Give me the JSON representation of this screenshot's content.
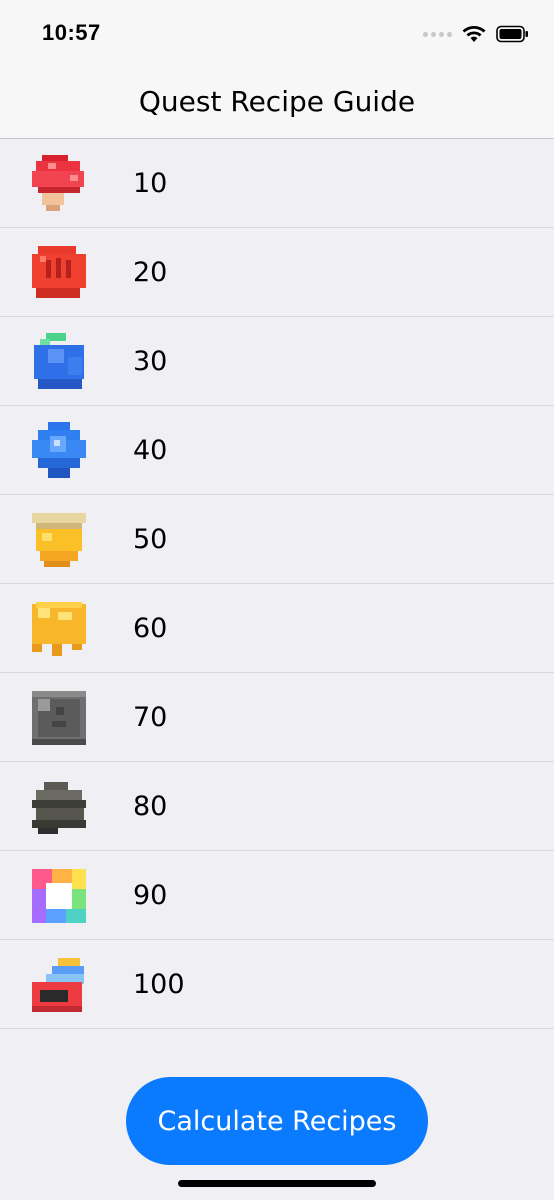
{
  "status_bar": {
    "time": "10:57"
  },
  "navbar": {
    "title": "Quest Recipe Guide"
  },
  "list": {
    "items": [
      {
        "label": "10",
        "icon": "red-mushroom-icon"
      },
      {
        "label": "20",
        "icon": "red-fist-icon"
      },
      {
        "label": "30",
        "icon": "blue-blob-icon"
      },
      {
        "label": "40",
        "icon": "blue-gem-icon"
      },
      {
        "label": "50",
        "icon": "honey-pot-icon"
      },
      {
        "label": "60",
        "icon": "honey-cheese-icon"
      },
      {
        "label": "70",
        "icon": "gray-block-icon"
      },
      {
        "label": "80",
        "icon": "dark-stone-icon"
      },
      {
        "label": "90",
        "icon": "rainbow-gem-icon"
      },
      {
        "label": "100",
        "icon": "stacked-items-icon"
      }
    ]
  },
  "button": {
    "label": "Calculate Recipes"
  },
  "colors": {
    "accent": "#0a7aff",
    "background": "#f0eff4",
    "bar": "#f7f7f7"
  }
}
